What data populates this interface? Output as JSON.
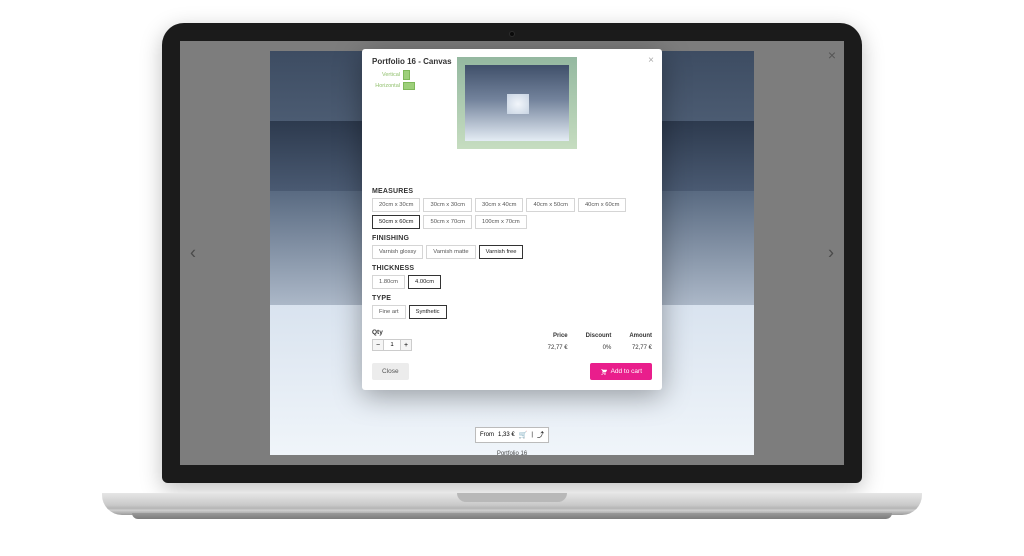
{
  "modal": {
    "title": "Portfolio 16 - Canvas",
    "orientation": {
      "vertical": "Vertical",
      "horizontal": "Horizontal"
    },
    "sections": {
      "measures": {
        "heading": "MEASURES",
        "options": [
          "20cm x 30cm",
          "30cm x 30cm",
          "30cm x 40cm",
          "40cm x 50cm",
          "40cm x 60cm",
          "50cm x 60cm",
          "50cm x 70cm",
          "100cm x 70cm"
        ],
        "selected": "50cm x 60cm"
      },
      "finishing": {
        "heading": "FINISHING",
        "options": [
          "Varnish glossy",
          "Varnish matte",
          "Varnish free"
        ],
        "selected": "Varnish free"
      },
      "thickness": {
        "heading": "THICKNESS",
        "options": [
          "1.80cm",
          "4.00cm"
        ],
        "selected": "4.00cm"
      },
      "type": {
        "heading": "TYPE",
        "options": [
          "Fine art",
          "Synthetic"
        ],
        "selected": "Synthetic"
      }
    },
    "qty_label": "Qty",
    "qty_value": "1",
    "price": {
      "heading": "Price",
      "value": "72,77 €"
    },
    "discount": {
      "heading": "Discount",
      "value": "0%"
    },
    "amount": {
      "heading": "Amount",
      "value": "72,77 €"
    },
    "close_label": "Close",
    "cart_label": "Add to cart"
  },
  "backdrop": {
    "caption_prefix": "From",
    "caption_price": "1,33 €",
    "portfolio_label": "Portfolio 16"
  }
}
